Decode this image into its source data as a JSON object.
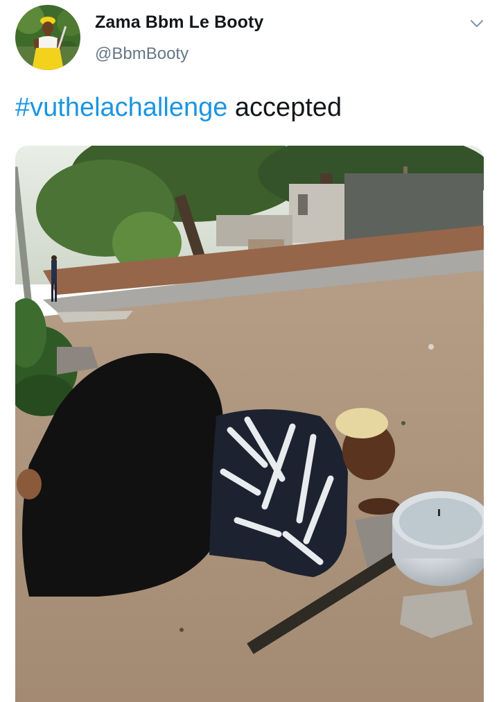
{
  "author": {
    "display_name": "Zama Bbm Le Booty",
    "handle": "@BbmBooty",
    "avatar_icon": "profile-photo-avatar"
  },
  "tweet": {
    "hashtag": "#vuthelachallenge",
    "text": "accepted"
  },
  "menu": {
    "icon": "chevron-down-icon"
  },
  "media": {
    "type": "photo"
  },
  "colors": {
    "hashtag": "#1b95e0",
    "handle": "#657786",
    "text": "#14171a",
    "chevron": "#8899a6"
  }
}
